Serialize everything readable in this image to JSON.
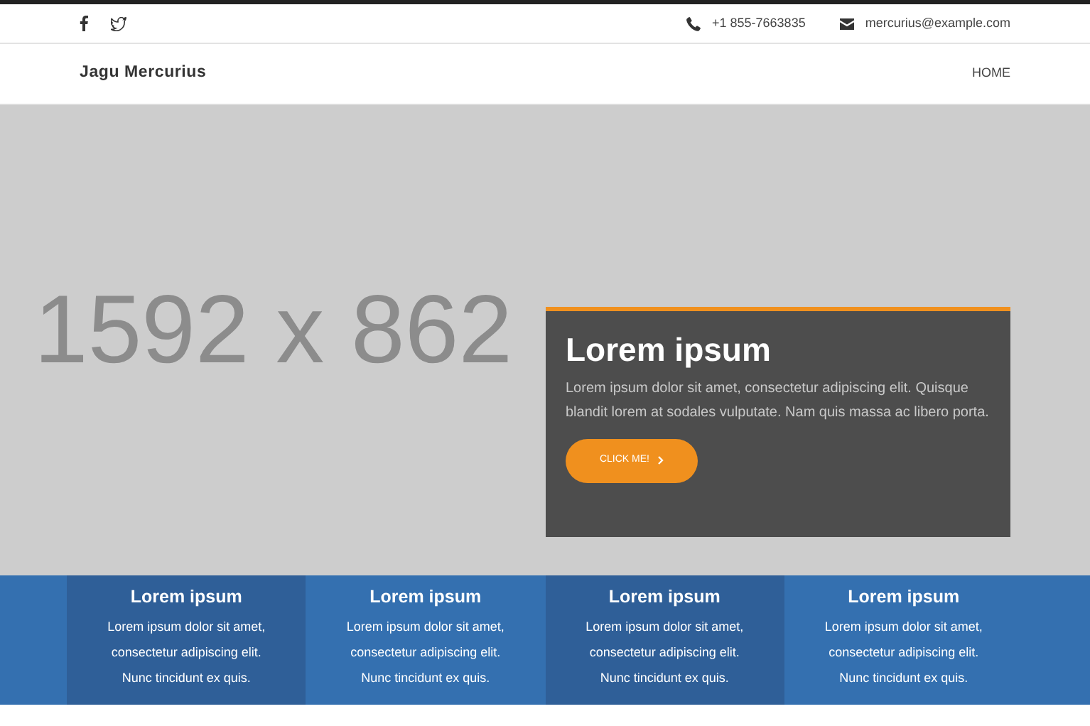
{
  "topbar": {
    "social": [
      {
        "kind": "facebook"
      },
      {
        "kind": "twitter"
      }
    ],
    "phone": "+1 855-7663835",
    "email": "mercurius@example.com"
  },
  "navbar": {
    "brand": "Jagu Mercurius",
    "links": [
      {
        "label": "HOME"
      }
    ]
  },
  "hero": {
    "placeholder_label": "1592 x 862",
    "card": {
      "title": "Lorem ipsum",
      "text": "Lorem ipsum dolor sit amet, consectetur adipiscing elit. Quisque blandit lorem at sodales vulputate. Nam quis massa ac libero porta.",
      "button": "CLICK ME!"
    }
  },
  "features": [
    {
      "title": "Lorem ipsum",
      "lines": [
        "Lorem ipsum dolor sit amet,",
        "consectetur adipiscing elit.",
        "Nunc tincidunt ex quis."
      ],
      "color": "#2f5f98"
    },
    {
      "title": "Lorem ipsum",
      "lines": [
        "Lorem ipsum dolor sit amet,",
        "consectetur adipiscing elit.",
        "Nunc tincidunt ex quis."
      ],
      "color": "#3470b0"
    },
    {
      "title": "Lorem ipsum",
      "lines": [
        "Lorem ipsum dolor sit amet,",
        "consectetur adipiscing elit.",
        "Nunc tincidunt ex quis."
      ],
      "color": "#2f5f98"
    },
    {
      "title": "Lorem ipsum",
      "lines": [
        "Lorem ipsum dolor sit amet,",
        "consectetur adipiscing elit.",
        "Nunc tincidunt ex quis."
      ],
      "color": "#3470b0"
    }
  ]
}
